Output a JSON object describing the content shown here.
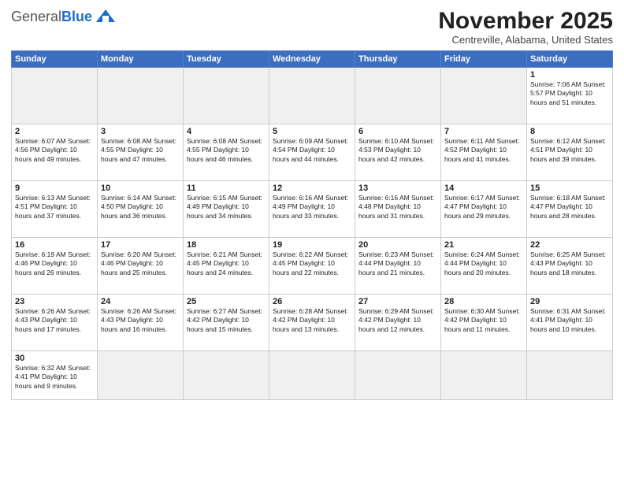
{
  "header": {
    "logo_general": "General",
    "logo_blue": "Blue",
    "title": "November 2025",
    "subtitle": "Centreville, Alabama, United States"
  },
  "weekdays": [
    "Sunday",
    "Monday",
    "Tuesday",
    "Wednesday",
    "Thursday",
    "Friday",
    "Saturday"
  ],
  "weeks": [
    [
      {
        "day": "",
        "info": ""
      },
      {
        "day": "",
        "info": ""
      },
      {
        "day": "",
        "info": ""
      },
      {
        "day": "",
        "info": ""
      },
      {
        "day": "",
        "info": ""
      },
      {
        "day": "",
        "info": ""
      },
      {
        "day": "1",
        "info": "Sunrise: 7:06 AM\nSunset: 5:57 PM\nDaylight: 10 hours\nand 51 minutes."
      }
    ],
    [
      {
        "day": "2",
        "info": "Sunrise: 6:07 AM\nSunset: 4:56 PM\nDaylight: 10 hours\nand 49 minutes."
      },
      {
        "day": "3",
        "info": "Sunrise: 6:08 AM\nSunset: 4:55 PM\nDaylight: 10 hours\nand 47 minutes."
      },
      {
        "day": "4",
        "info": "Sunrise: 6:08 AM\nSunset: 4:55 PM\nDaylight: 10 hours\nand 46 minutes."
      },
      {
        "day": "5",
        "info": "Sunrise: 6:09 AM\nSunset: 4:54 PM\nDaylight: 10 hours\nand 44 minutes."
      },
      {
        "day": "6",
        "info": "Sunrise: 6:10 AM\nSunset: 4:53 PM\nDaylight: 10 hours\nand 42 minutes."
      },
      {
        "day": "7",
        "info": "Sunrise: 6:11 AM\nSunset: 4:52 PM\nDaylight: 10 hours\nand 41 minutes."
      },
      {
        "day": "8",
        "info": "Sunrise: 6:12 AM\nSunset: 4:51 PM\nDaylight: 10 hours\nand 39 minutes."
      }
    ],
    [
      {
        "day": "9",
        "info": "Sunrise: 6:13 AM\nSunset: 4:51 PM\nDaylight: 10 hours\nand 37 minutes."
      },
      {
        "day": "10",
        "info": "Sunrise: 6:14 AM\nSunset: 4:50 PM\nDaylight: 10 hours\nand 36 minutes."
      },
      {
        "day": "11",
        "info": "Sunrise: 6:15 AM\nSunset: 4:49 PM\nDaylight: 10 hours\nand 34 minutes."
      },
      {
        "day": "12",
        "info": "Sunrise: 6:16 AM\nSunset: 4:49 PM\nDaylight: 10 hours\nand 33 minutes."
      },
      {
        "day": "13",
        "info": "Sunrise: 6:16 AM\nSunset: 4:48 PM\nDaylight: 10 hours\nand 31 minutes."
      },
      {
        "day": "14",
        "info": "Sunrise: 6:17 AM\nSunset: 4:47 PM\nDaylight: 10 hours\nand 29 minutes."
      },
      {
        "day": "15",
        "info": "Sunrise: 6:18 AM\nSunset: 4:47 PM\nDaylight: 10 hours\nand 28 minutes."
      }
    ],
    [
      {
        "day": "16",
        "info": "Sunrise: 6:19 AM\nSunset: 4:46 PM\nDaylight: 10 hours\nand 26 minutes."
      },
      {
        "day": "17",
        "info": "Sunrise: 6:20 AM\nSunset: 4:46 PM\nDaylight: 10 hours\nand 25 minutes."
      },
      {
        "day": "18",
        "info": "Sunrise: 6:21 AM\nSunset: 4:45 PM\nDaylight: 10 hours\nand 24 minutes."
      },
      {
        "day": "19",
        "info": "Sunrise: 6:22 AM\nSunset: 4:45 PM\nDaylight: 10 hours\nand 22 minutes."
      },
      {
        "day": "20",
        "info": "Sunrise: 6:23 AM\nSunset: 4:44 PM\nDaylight: 10 hours\nand 21 minutes."
      },
      {
        "day": "21",
        "info": "Sunrise: 6:24 AM\nSunset: 4:44 PM\nDaylight: 10 hours\nand 20 minutes."
      },
      {
        "day": "22",
        "info": "Sunrise: 6:25 AM\nSunset: 4:43 PM\nDaylight: 10 hours\nand 18 minutes."
      }
    ],
    [
      {
        "day": "23",
        "info": "Sunrise: 6:26 AM\nSunset: 4:43 PM\nDaylight: 10 hours\nand 17 minutes."
      },
      {
        "day": "24",
        "info": "Sunrise: 6:26 AM\nSunset: 4:43 PM\nDaylight: 10 hours\nand 16 minutes."
      },
      {
        "day": "25",
        "info": "Sunrise: 6:27 AM\nSunset: 4:42 PM\nDaylight: 10 hours\nand 15 minutes."
      },
      {
        "day": "26",
        "info": "Sunrise: 6:28 AM\nSunset: 4:42 PM\nDaylight: 10 hours\nand 13 minutes."
      },
      {
        "day": "27",
        "info": "Sunrise: 6:29 AM\nSunset: 4:42 PM\nDaylight: 10 hours\nand 12 minutes."
      },
      {
        "day": "28",
        "info": "Sunrise: 6:30 AM\nSunset: 4:42 PM\nDaylight: 10 hours\nand 11 minutes."
      },
      {
        "day": "29",
        "info": "Sunrise: 6:31 AM\nSunset: 4:41 PM\nDaylight: 10 hours\nand 10 minutes."
      }
    ],
    [
      {
        "day": "30",
        "info": "Sunrise: 6:32 AM\nSunset: 4:41 PM\nDaylight: 10 hours\nand 9 minutes."
      },
      {
        "day": "",
        "info": ""
      },
      {
        "day": "",
        "info": ""
      },
      {
        "day": "",
        "info": ""
      },
      {
        "day": "",
        "info": ""
      },
      {
        "day": "",
        "info": ""
      },
      {
        "day": "",
        "info": ""
      }
    ]
  ]
}
